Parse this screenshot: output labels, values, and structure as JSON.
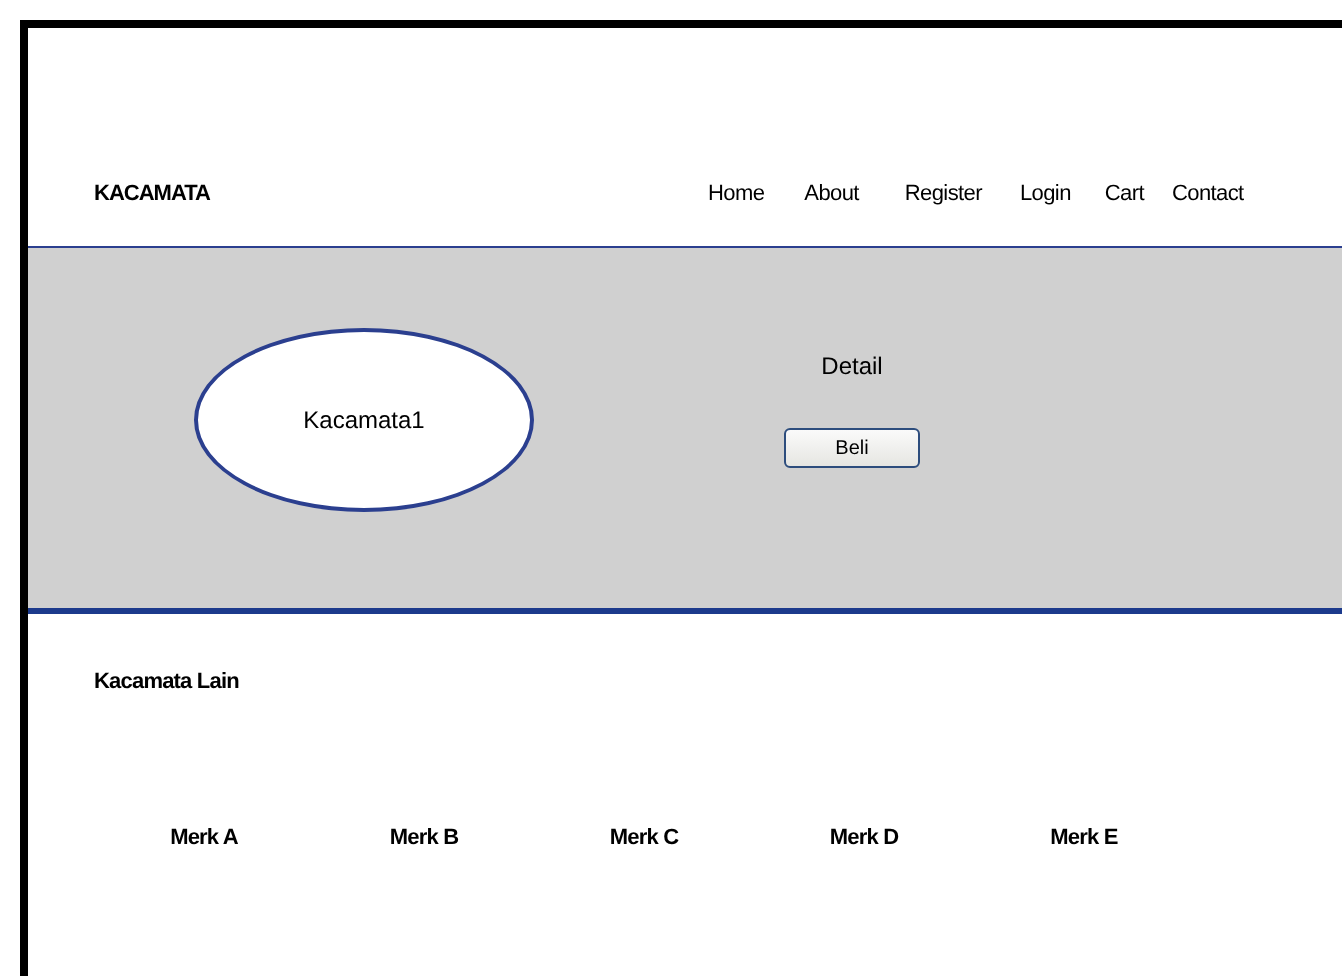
{
  "header": {
    "logo": "KACAMATA",
    "nav": [
      {
        "label": "Home"
      },
      {
        "label": "About"
      },
      {
        "label": "Register"
      },
      {
        "label": "Login"
      },
      {
        "label": "Cart"
      },
      {
        "label": "Contact"
      }
    ]
  },
  "product": {
    "image_label": "Kacamata1",
    "detail": "Detail",
    "button": "Beli"
  },
  "others": {
    "title": "Kacamata Lain",
    "items": [
      {
        "label": "Merk A"
      },
      {
        "label": "Merk B"
      },
      {
        "label": "Merk C"
      },
      {
        "label": "Merk D"
      },
      {
        "label": "Merk E"
      }
    ]
  }
}
